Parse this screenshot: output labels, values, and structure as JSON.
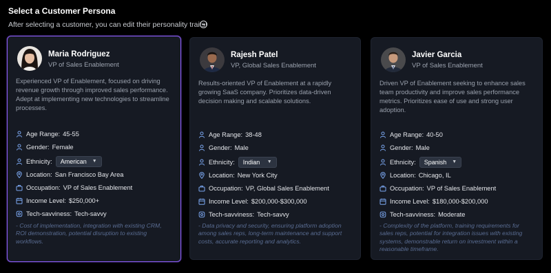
{
  "header": {
    "title": "Select a Customer Persona",
    "subtitle": "After selecting a customer, you can edit their personality traits!"
  },
  "labels": {
    "age": "Age Range:",
    "gender": "Gender:",
    "ethnicity": "Ethnicity:",
    "location": "Location:",
    "occupation": "Occupation:",
    "income": "Income Level:",
    "tech": "Tech-savviness:"
  },
  "accent_color": "#8b5cf6",
  "icon_color": "#7ba7f0",
  "personas": [
    {
      "name": "Maria Rodriguez",
      "role": "VP of Sales Enablement",
      "description": "Experienced VP of Enablement, focused on driving revenue growth through improved sales performance. Adept at implementing new technologies to streamline processes.",
      "age": "45-55",
      "gender": "Female",
      "ethnicity": "American",
      "location": "San Francisco Bay Area",
      "occupation": "VP of Sales Enablement",
      "income": "$250,000+",
      "tech": "Tech-savvy",
      "concerns": "- Cost of implementation, integration with existing CRM, ROI demonstration, potential disruption to existing workflows.",
      "selected": true
    },
    {
      "name": "Rajesh Patel",
      "role": "VP, Global Sales Enablement",
      "description": "Results-oriented VP of Enablement at a rapidly growing SaaS company. Prioritizes data-driven decision making and scalable solutions.",
      "age": "38-48",
      "gender": "Male",
      "ethnicity": "Indian",
      "location": "New York City",
      "occupation": "VP, Global Sales Enablement",
      "income": "$200,000-$300,000",
      "tech": "Tech-savvy",
      "concerns": "- Data privacy and security, ensuring platform adoption among sales reps, long-term maintenance and support costs, accurate reporting and analytics.",
      "selected": false
    },
    {
      "name": "Javier Garcia",
      "role": "VP of Sales Enablement",
      "description": "Driven VP of Enablement seeking to enhance sales team productivity and improve sales performance metrics. Prioritizes ease of use and strong user adoption.",
      "age": "40-50",
      "gender": "Male",
      "ethnicity": "Spanish",
      "location": "Chicago, IL",
      "occupation": "VP of Sales Enablement",
      "income": "$180,000-$200,000",
      "tech": "Moderate",
      "concerns": "- Complexity of the platform, training requirements for sales reps, potential for integration issues with existing systems, demonstrable return on investment within a reasonable timeframe.",
      "selected": false
    }
  ]
}
